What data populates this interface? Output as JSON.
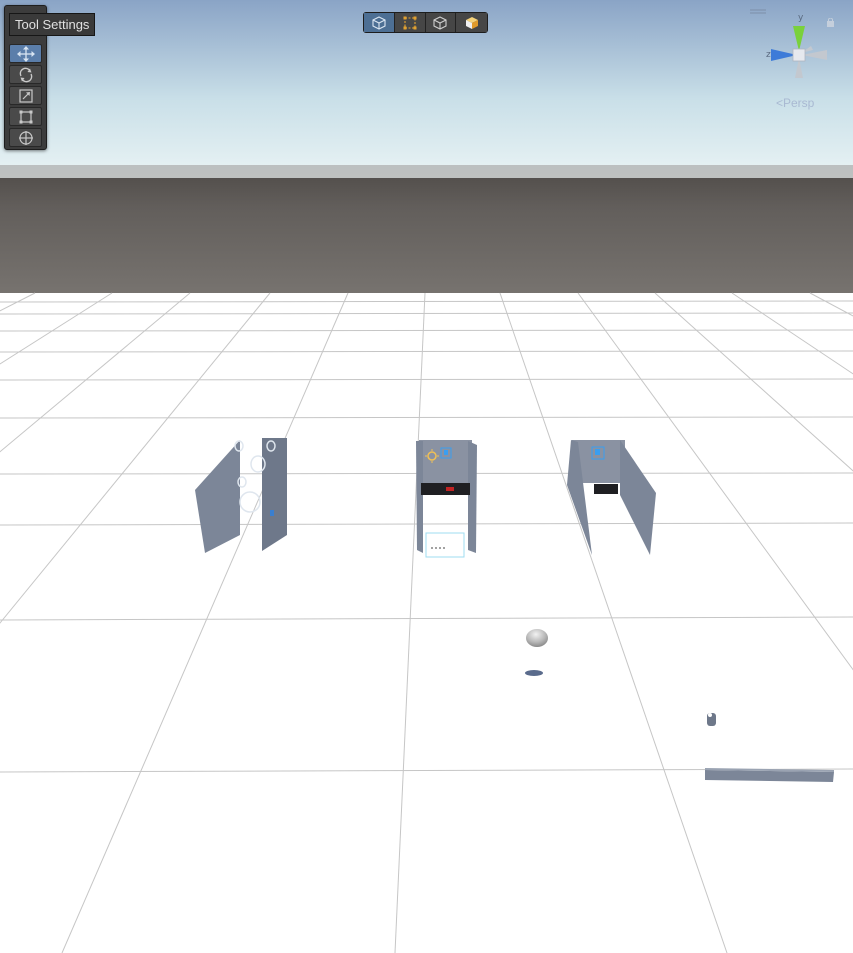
{
  "tooltip": {
    "text": "Tool Settings"
  },
  "tool_palette": {
    "tools": [
      {
        "name": "move-tool",
        "icon": "move-arrows-icon",
        "active": true
      },
      {
        "name": "rotate-tool",
        "icon": "rotate-icon",
        "active": false
      },
      {
        "name": "scale-tool",
        "icon": "scale-icon",
        "active": false
      },
      {
        "name": "rect-tool",
        "icon": "rect-transform-icon",
        "active": false
      },
      {
        "name": "transform-tool",
        "icon": "transform-icon",
        "active": false
      }
    ]
  },
  "draw_mode_toolbar": {
    "buttons": [
      {
        "name": "shaded-mode",
        "icon": "cube-outline-icon",
        "active": true
      },
      {
        "name": "rect-mode",
        "icon": "rect-dashed-icon",
        "active": false
      },
      {
        "name": "wire-mode",
        "icon": "cube-wire-icon",
        "active": false
      },
      {
        "name": "shaded-orange-mode",
        "icon": "cube-orange-icon",
        "active": false
      }
    ]
  },
  "gizmo": {
    "axis_label_y": "y",
    "axis_label_z": "z",
    "projection_label": "<Persp"
  },
  "colors": {
    "sky_top": "#8aa5c8",
    "sky_horizon": "#e9f3f5",
    "ground_far": "#5e5a57",
    "ground_near": "#777370",
    "floor": "#ffffff",
    "grid": "#c8c8c8",
    "object": "#7c8698",
    "accent": "#5b7eaa",
    "gizmo_y": "#7ad13b",
    "gizmo_z": "#3d7bd8"
  }
}
